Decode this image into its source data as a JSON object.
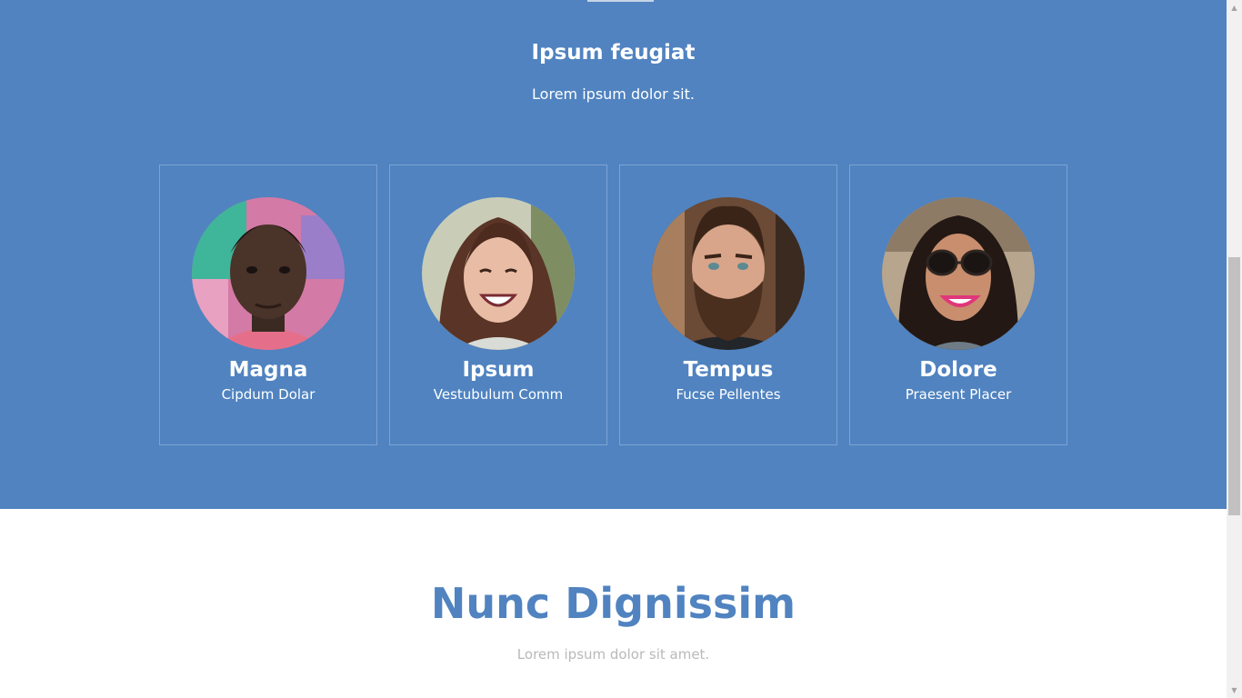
{
  "team": {
    "title": "Ipsum feugiat",
    "subtitle": "Lorem ipsum dolor sit.",
    "members": [
      {
        "name": "Magna",
        "role": "Cipdum Dolar"
      },
      {
        "name": "Ipsum",
        "role": "Vestubulum Comm"
      },
      {
        "name": "Tempus",
        "role": "Fucse Pellentes"
      },
      {
        "name": "Dolore",
        "role": "Praesent Placer"
      }
    ]
  },
  "next_section": {
    "title": "Nunc Dignissim",
    "subtitle": "Lorem ipsum dolor sit amet."
  },
  "colors": {
    "accent_blue": "#5083c0",
    "card_border": "#7ea3d2",
    "muted_text": "#b9b9b9"
  },
  "icons": {
    "scroll_up": "chevron-up-icon",
    "scroll_down": "chevron-down-icon"
  }
}
